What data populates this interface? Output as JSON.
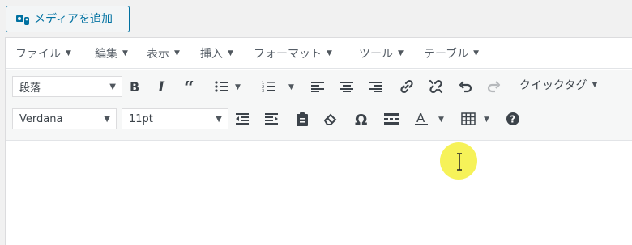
{
  "media_button": {
    "label": "メディアを追加",
    "icon": "media-add-icon"
  },
  "menubar": {
    "items": [
      {
        "label": "ファイル"
      },
      {
        "label": "編集"
      },
      {
        "label": "表示"
      },
      {
        "label": "挿入"
      },
      {
        "label": "フォーマット"
      },
      {
        "label": "ツール"
      },
      {
        "label": "テーブル"
      }
    ]
  },
  "toolbar": {
    "format_select": {
      "value": "段落"
    },
    "quick_tag": {
      "label": "クイックタグ"
    },
    "font_select": {
      "value": "Verdana"
    },
    "size_select": {
      "value": "11pt"
    }
  },
  "colors": {
    "accent": "#0071a1",
    "highlight": "#f5f03c"
  }
}
